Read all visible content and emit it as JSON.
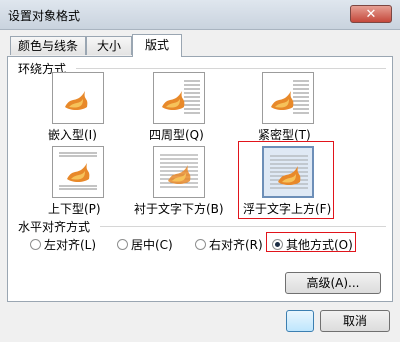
{
  "window": {
    "title": "设置对象格式",
    "close_glyph": "✕"
  },
  "tabs": [
    {
      "label": "颜色与线条",
      "active": false
    },
    {
      "label": "大小",
      "active": false
    },
    {
      "label": "版式",
      "active": true
    }
  ],
  "wrapping": {
    "section_label": "环绕方式",
    "styles": [
      {
        "label": "嵌入型(I)",
        "icon": "inline-icon",
        "selected": false
      },
      {
        "label": "四周型(Q)",
        "icon": "square-wrap-icon",
        "selected": false
      },
      {
        "label": "紧密型(T)",
        "icon": "tight-wrap-icon",
        "selected": false
      },
      {
        "label": "上下型(P)",
        "icon": "top-bottom-icon",
        "selected": false
      },
      {
        "label": "衬于文字下方(B)",
        "icon": "behind-text-icon",
        "selected": false
      },
      {
        "label": "浮于文字上方(F)",
        "icon": "in-front-of-text-icon",
        "selected": true
      }
    ]
  },
  "alignment": {
    "section_label": "水平对齐方式",
    "options": [
      {
        "label": "左对齐(L)",
        "checked": false
      },
      {
        "label": "居中(C)",
        "checked": false
      },
      {
        "label": "右对齐(R)",
        "checked": false
      },
      {
        "label": "其他方式(O)",
        "checked": true
      }
    ]
  },
  "buttons": {
    "advanced": "高级(A)...",
    "ok": "",
    "cancel": "取消"
  },
  "colors": {
    "highlight_box": "#e1141b",
    "selected_tile": "#dfe9f5",
    "flame": "#e8892a"
  }
}
